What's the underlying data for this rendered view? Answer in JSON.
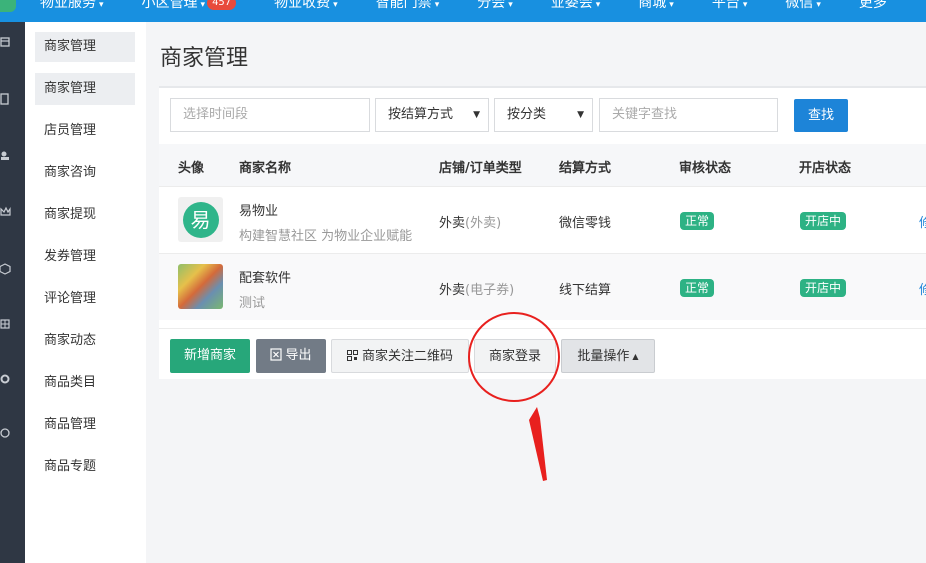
{
  "topnav": {
    "items": [
      {
        "label": "物业服务"
      },
      {
        "label": "小区管理",
        "badge": "457"
      },
      {
        "label": "物业收费"
      },
      {
        "label": "智能门禁"
      },
      {
        "label": "分会"
      },
      {
        "label": "业委会"
      },
      {
        "label": "商城"
      },
      {
        "label": "平台"
      },
      {
        "label": "微信"
      },
      {
        "label": "更多"
      }
    ],
    "caret": "▾"
  },
  "sidebar": {
    "title": "商家管理",
    "items": [
      "商家管理",
      "店员管理",
      "商家咨询",
      "商家提现",
      "发券管理",
      "评论管理",
      "商家动态",
      "商品类目",
      "商品管理",
      "商品专题"
    ]
  },
  "page": {
    "title": "商家管理"
  },
  "filters": {
    "time_placeholder": "选择时间段",
    "settle_select": "按结算方式",
    "category_select": "按分类",
    "keyword_placeholder": "关键字查找",
    "search_button": "查找"
  },
  "table": {
    "headers": [
      "头像",
      "商家名称",
      "店铺/订单类型",
      "结算方式",
      "审核状态",
      "开店状态"
    ],
    "rows": [
      {
        "avatar_text": "易",
        "name": "易物业",
        "desc": "构建智慧社区 为物业企业赋能",
        "type": "外卖",
        "type_sub": "(外卖)",
        "settle": "微信零钱",
        "audit": "正常",
        "open": "开店中",
        "action": "修"
      },
      {
        "avatar_text": "",
        "name": "配套软件",
        "desc": "测试",
        "type": "外卖",
        "type_sub": "(电子券)",
        "settle": "线下结算",
        "audit": "正常",
        "open": "开店中",
        "action": "修"
      }
    ]
  },
  "actions": {
    "add": "新增商家",
    "export": "导出",
    "qrcode": "商家关注二维码",
    "login": "商家登录",
    "batch": "批量操作"
  },
  "colors": {
    "topbar": "#1890e0",
    "rail": "#2f3744",
    "accent_green": "#2db284",
    "search_blue": "#1d84d8",
    "annotation_red": "#e8201e"
  }
}
